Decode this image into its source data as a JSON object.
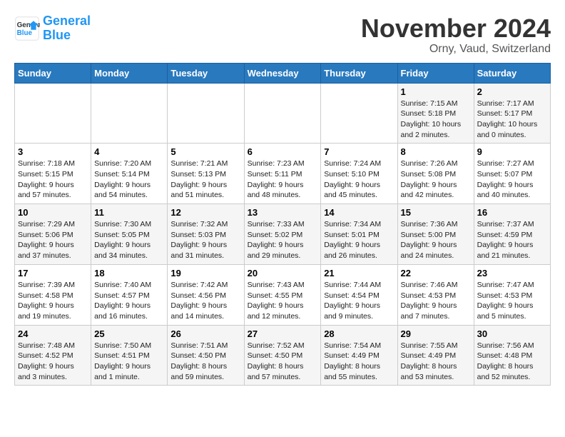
{
  "header": {
    "logo_line1": "General",
    "logo_line2": "Blue",
    "month": "November 2024",
    "location": "Orny, Vaud, Switzerland"
  },
  "weekdays": [
    "Sunday",
    "Monday",
    "Tuesday",
    "Wednesday",
    "Thursday",
    "Friday",
    "Saturday"
  ],
  "weeks": [
    [
      {
        "day": "",
        "info": ""
      },
      {
        "day": "",
        "info": ""
      },
      {
        "day": "",
        "info": ""
      },
      {
        "day": "",
        "info": ""
      },
      {
        "day": "",
        "info": ""
      },
      {
        "day": "1",
        "info": "Sunrise: 7:15 AM\nSunset: 5:18 PM\nDaylight: 10 hours\nand 2 minutes."
      },
      {
        "day": "2",
        "info": "Sunrise: 7:17 AM\nSunset: 5:17 PM\nDaylight: 10 hours\nand 0 minutes."
      }
    ],
    [
      {
        "day": "3",
        "info": "Sunrise: 7:18 AM\nSunset: 5:15 PM\nDaylight: 9 hours\nand 57 minutes."
      },
      {
        "day": "4",
        "info": "Sunrise: 7:20 AM\nSunset: 5:14 PM\nDaylight: 9 hours\nand 54 minutes."
      },
      {
        "day": "5",
        "info": "Sunrise: 7:21 AM\nSunset: 5:13 PM\nDaylight: 9 hours\nand 51 minutes."
      },
      {
        "day": "6",
        "info": "Sunrise: 7:23 AM\nSunset: 5:11 PM\nDaylight: 9 hours\nand 48 minutes."
      },
      {
        "day": "7",
        "info": "Sunrise: 7:24 AM\nSunset: 5:10 PM\nDaylight: 9 hours\nand 45 minutes."
      },
      {
        "day": "8",
        "info": "Sunrise: 7:26 AM\nSunset: 5:08 PM\nDaylight: 9 hours\nand 42 minutes."
      },
      {
        "day": "9",
        "info": "Sunrise: 7:27 AM\nSunset: 5:07 PM\nDaylight: 9 hours\nand 40 minutes."
      }
    ],
    [
      {
        "day": "10",
        "info": "Sunrise: 7:29 AM\nSunset: 5:06 PM\nDaylight: 9 hours\nand 37 minutes."
      },
      {
        "day": "11",
        "info": "Sunrise: 7:30 AM\nSunset: 5:05 PM\nDaylight: 9 hours\nand 34 minutes."
      },
      {
        "day": "12",
        "info": "Sunrise: 7:32 AM\nSunset: 5:03 PM\nDaylight: 9 hours\nand 31 minutes."
      },
      {
        "day": "13",
        "info": "Sunrise: 7:33 AM\nSunset: 5:02 PM\nDaylight: 9 hours\nand 29 minutes."
      },
      {
        "day": "14",
        "info": "Sunrise: 7:34 AM\nSunset: 5:01 PM\nDaylight: 9 hours\nand 26 minutes."
      },
      {
        "day": "15",
        "info": "Sunrise: 7:36 AM\nSunset: 5:00 PM\nDaylight: 9 hours\nand 24 minutes."
      },
      {
        "day": "16",
        "info": "Sunrise: 7:37 AM\nSunset: 4:59 PM\nDaylight: 9 hours\nand 21 minutes."
      }
    ],
    [
      {
        "day": "17",
        "info": "Sunrise: 7:39 AM\nSunset: 4:58 PM\nDaylight: 9 hours\nand 19 minutes."
      },
      {
        "day": "18",
        "info": "Sunrise: 7:40 AM\nSunset: 4:57 PM\nDaylight: 9 hours\nand 16 minutes."
      },
      {
        "day": "19",
        "info": "Sunrise: 7:42 AM\nSunset: 4:56 PM\nDaylight: 9 hours\nand 14 minutes."
      },
      {
        "day": "20",
        "info": "Sunrise: 7:43 AM\nSunset: 4:55 PM\nDaylight: 9 hours\nand 12 minutes."
      },
      {
        "day": "21",
        "info": "Sunrise: 7:44 AM\nSunset: 4:54 PM\nDaylight: 9 hours\nand 9 minutes."
      },
      {
        "day": "22",
        "info": "Sunrise: 7:46 AM\nSunset: 4:53 PM\nDaylight: 9 hours\nand 7 minutes."
      },
      {
        "day": "23",
        "info": "Sunrise: 7:47 AM\nSunset: 4:53 PM\nDaylight: 9 hours\nand 5 minutes."
      }
    ],
    [
      {
        "day": "24",
        "info": "Sunrise: 7:48 AM\nSunset: 4:52 PM\nDaylight: 9 hours\nand 3 minutes."
      },
      {
        "day": "25",
        "info": "Sunrise: 7:50 AM\nSunset: 4:51 PM\nDaylight: 9 hours\nand 1 minute."
      },
      {
        "day": "26",
        "info": "Sunrise: 7:51 AM\nSunset: 4:50 PM\nDaylight: 8 hours\nand 59 minutes."
      },
      {
        "day": "27",
        "info": "Sunrise: 7:52 AM\nSunset: 4:50 PM\nDaylight: 8 hours\nand 57 minutes."
      },
      {
        "day": "28",
        "info": "Sunrise: 7:54 AM\nSunset: 4:49 PM\nDaylight: 8 hours\nand 55 minutes."
      },
      {
        "day": "29",
        "info": "Sunrise: 7:55 AM\nSunset: 4:49 PM\nDaylight: 8 hours\nand 53 minutes."
      },
      {
        "day": "30",
        "info": "Sunrise: 7:56 AM\nSunset: 4:48 PM\nDaylight: 8 hours\nand 52 minutes."
      }
    ]
  ]
}
